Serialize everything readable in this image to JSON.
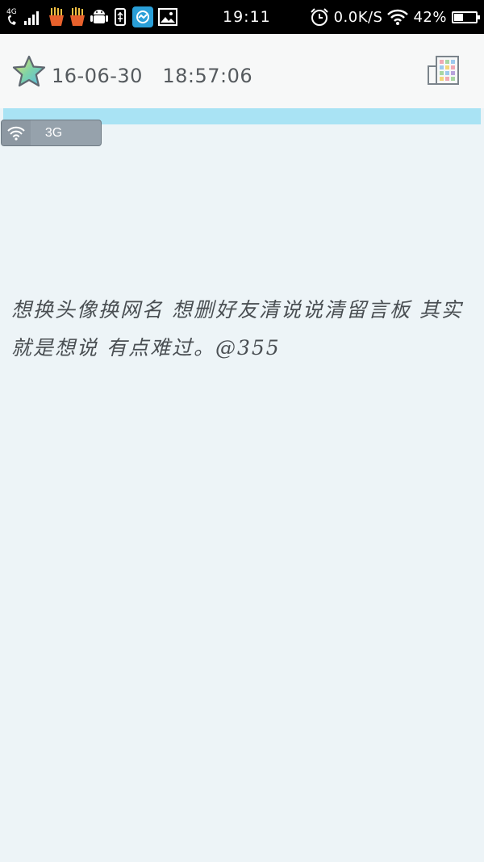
{
  "status_bar": {
    "network_type": "4G",
    "time": "19:11",
    "net_speed": "0.0K/S",
    "battery": "42%",
    "battery_level": 0.42,
    "icons": [
      "call-signal-icon",
      "fries-icon",
      "fries-icon",
      "android-icon",
      "usb-icon",
      "browser-app-icon",
      "image-icon",
      "alarm-icon",
      "wifi-icon",
      "battery-icon"
    ]
  },
  "header": {
    "date": "16-06-30",
    "time": "18:57:06",
    "icons": [
      "star-icon",
      "grid-menu-icon"
    ]
  },
  "network_pill": {
    "label": "3G",
    "icon": "wifi-icon"
  },
  "post": {
    "text": "想换头像换网名 想删好友清说说清留言板 其实就是想说 有点难过。@355"
  },
  "colors": {
    "background": "#edf4f7",
    "status_bar": "#000000",
    "header": "#f7f8f8",
    "accent_strip": "#a9e3f4",
    "text": "#4a4f53"
  }
}
